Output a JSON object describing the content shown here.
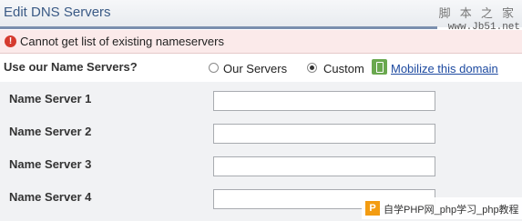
{
  "header": {
    "title": "Edit DNS Servers"
  },
  "watermark": {
    "top_chars": "脚 本 之 家",
    "top_url": "www.Jb51.net",
    "bottom_text": "自学PHP网_php学习_php教程",
    "logo": "P"
  },
  "error": {
    "icon": "error-icon",
    "message": "Cannot get list of existing nameservers"
  },
  "nameserver_choice": {
    "label": "Use our Name Servers?",
    "options": [
      {
        "label": "Our Servers",
        "selected": false
      },
      {
        "label": "Custom",
        "selected": true
      }
    ],
    "mobilize_link": "Mobilize this domain"
  },
  "nameservers": [
    {
      "label": "Name Server 1",
      "value": ""
    },
    {
      "label": "Name Server 2",
      "value": ""
    },
    {
      "label": "Name Server 3",
      "value": ""
    },
    {
      "label": "Name Server 4",
      "value": ""
    }
  ]
}
